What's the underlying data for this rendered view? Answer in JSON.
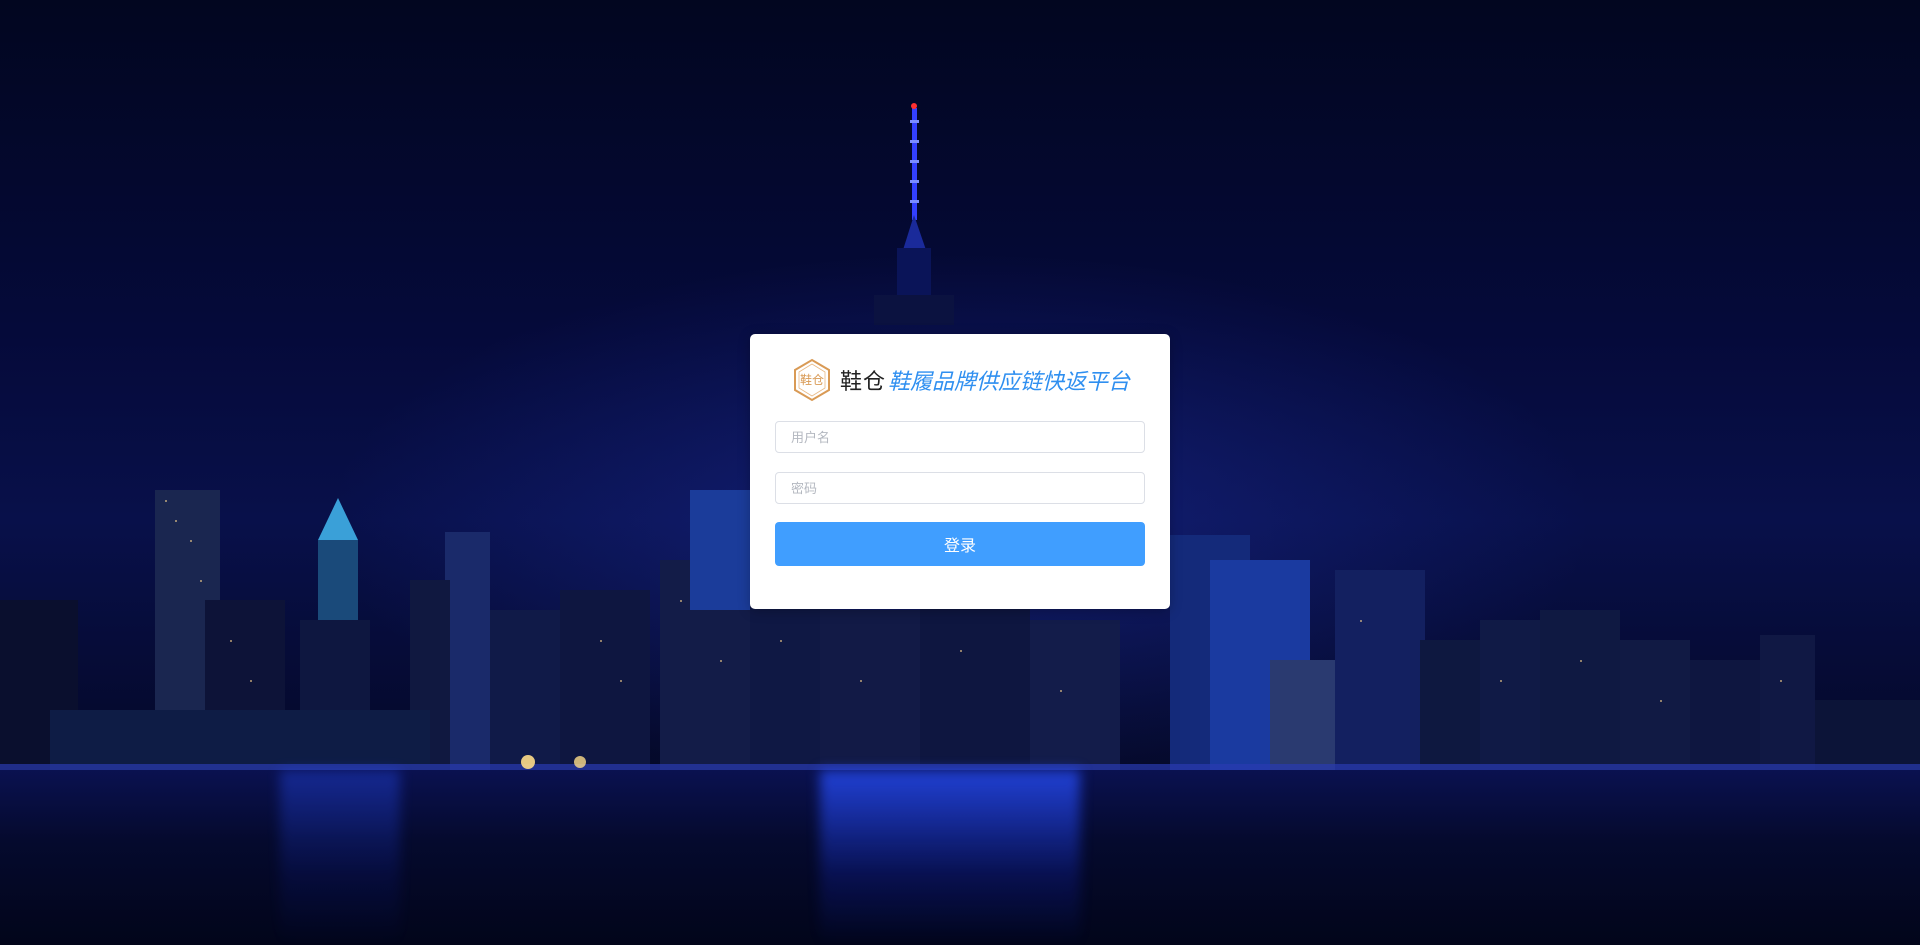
{
  "brand": {
    "logo_text": "鞋仓",
    "name": "鞋仓",
    "slogan": "鞋履品牌供应链快返平台",
    "accent_color": "#2f8ff0",
    "logo_color": "#d99a55"
  },
  "form": {
    "username_placeholder": "用户名",
    "password_placeholder": "密码",
    "login_label": "登录",
    "button_color": "#409eff"
  },
  "background": {
    "description_icon": "city-night-skyline"
  }
}
